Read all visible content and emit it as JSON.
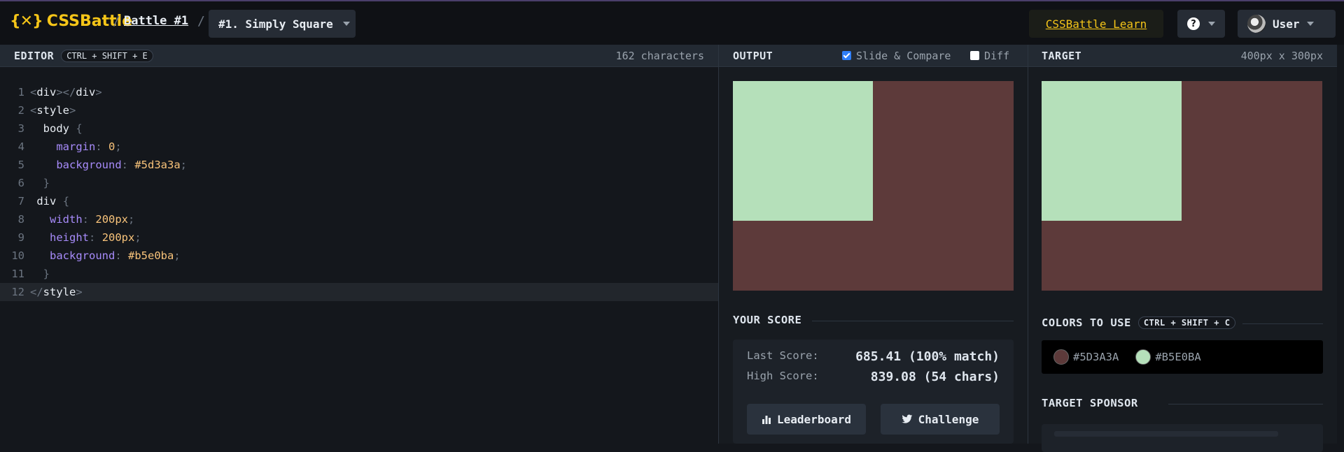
{
  "header": {
    "logo_text": "CSSBattle",
    "battle_link": "Battle #1",
    "level_select": "#1. Simply Square",
    "learn_button": "CSSBattle Learn",
    "help_icon_text": "?",
    "user_label": "User",
    "accent_color": "#f5c518"
  },
  "editor": {
    "title": "EDITOR",
    "shortcut": "CTRL + SHIFT + E",
    "char_count": "162 characters",
    "lines": [
      "1",
      "2",
      "3",
      "4",
      "5",
      "6",
      "7",
      "8",
      "9",
      "10",
      "11",
      "12"
    ]
  },
  "output": {
    "title": "OUTPUT",
    "slide_compare_label": "Slide & Compare",
    "slide_compare_checked": true,
    "diff_label": "Diff",
    "diff_checked": false
  },
  "target": {
    "title": "TARGET",
    "size_label": "400px x 300px"
  },
  "score": {
    "title": "YOUR SCORE",
    "last_label": "Last Score:",
    "last_value": "685.41 (100% match)",
    "high_label": "High Score:",
    "high_value": "839.08 (54 chars)",
    "leaderboard_button": "Leaderboard",
    "challenge_button": "Challenge"
  },
  "colors": {
    "title": "COLORS TO USE",
    "shortcut": "CTRL + SHIFT + C",
    "swatches": [
      {
        "hex": "#5D3A3A",
        "color": "#5d3a3a"
      },
      {
        "hex": "#B5E0BA",
        "color": "#b5e0ba"
      }
    ]
  },
  "sponsor": {
    "title": "TARGET SPONSOR"
  }
}
